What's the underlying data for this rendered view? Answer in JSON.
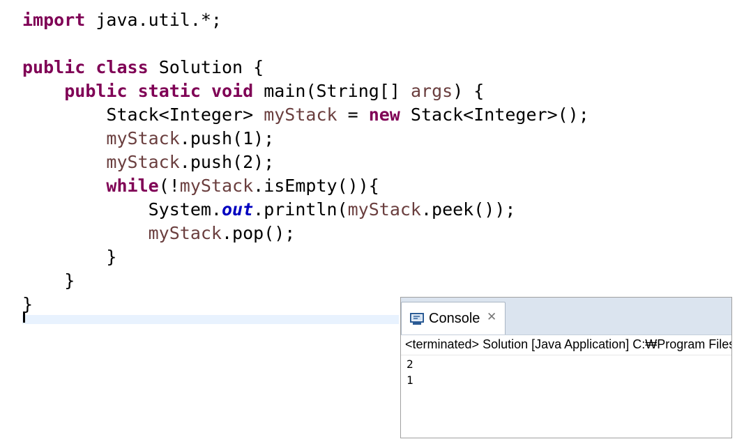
{
  "editor": {
    "lines": [
      [
        {
          "t": "import",
          "k": "kw"
        },
        {
          "t": " java.util.*;"
        }
      ],
      [],
      [
        {
          "t": "public",
          "k": "kw"
        },
        {
          "t": " "
        },
        {
          "t": "class",
          "k": "kw"
        },
        {
          "t": " Solution {"
        }
      ],
      [
        {
          "t": "    "
        },
        {
          "t": "public",
          "k": "kw"
        },
        {
          "t": " "
        },
        {
          "t": "static",
          "k": "kw"
        },
        {
          "t": " "
        },
        {
          "t": "void",
          "k": "kw"
        },
        {
          "t": " main(String[] "
        },
        {
          "t": "args",
          "k": "var"
        },
        {
          "t": ") {"
        }
      ],
      [
        {
          "t": "        Stack<Integer> "
        },
        {
          "t": "myStack",
          "k": "var"
        },
        {
          "t": " = "
        },
        {
          "t": "new",
          "k": "kw"
        },
        {
          "t": " Stack<Integer>();"
        }
      ],
      [
        {
          "t": "        "
        },
        {
          "t": "myStack",
          "k": "var"
        },
        {
          "t": ".push(1);"
        }
      ],
      [
        {
          "t": "        "
        },
        {
          "t": "myStack",
          "k": "var"
        },
        {
          "t": ".push(2);"
        }
      ],
      [
        {
          "t": "        "
        },
        {
          "t": "while",
          "k": "kw"
        },
        {
          "t": "(!"
        },
        {
          "t": "myStack",
          "k": "var"
        },
        {
          "t": ".isEmpty()){"
        }
      ],
      [
        {
          "t": "            System."
        },
        {
          "t": "out",
          "k": "field"
        },
        {
          "t": ".println("
        },
        {
          "t": "myStack",
          "k": "var"
        },
        {
          "t": ".peek());"
        }
      ],
      [
        {
          "t": "            "
        },
        {
          "t": "myStack",
          "k": "var"
        },
        {
          "t": ".pop();"
        }
      ],
      [
        {
          "t": "        }"
        }
      ],
      [
        {
          "t": "    }"
        }
      ],
      [
        {
          "t": "}"
        }
      ]
    ],
    "colors": {
      "keyword": "#7f0055",
      "local_variable": "#6a3e3e",
      "static_field": "#0000c0",
      "current_line": "#e8f2fe"
    }
  },
  "console": {
    "tab_label": "Console",
    "tab_icon": "console-monitor-icon",
    "close_icon": "close-icon",
    "close_glyph": "✕",
    "status": "<terminated> Solution [Java Application] C:₩Program Files",
    "output": [
      "2",
      "1"
    ]
  }
}
